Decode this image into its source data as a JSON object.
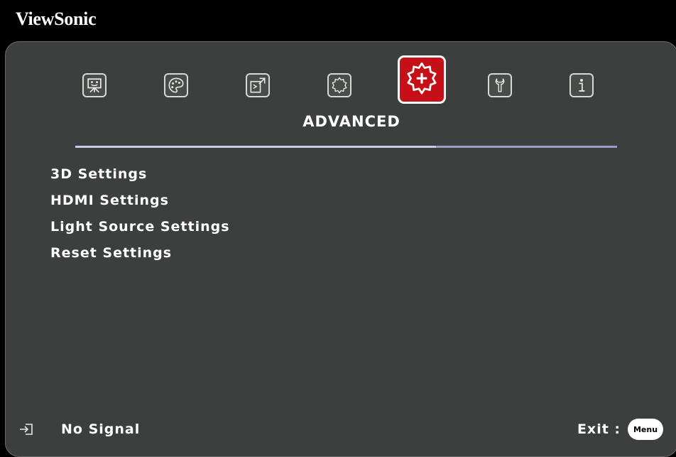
{
  "brand": "ViewSonic",
  "tabs": [
    {
      "icon": "display-icon",
      "active": false
    },
    {
      "icon": "palette-icon",
      "active": false
    },
    {
      "icon": "hand-touch-icon",
      "active": false
    },
    {
      "icon": "gear-icon",
      "active": false
    },
    {
      "icon": "gear-plus-icon",
      "active": true
    },
    {
      "icon": "wrench-icon",
      "active": false
    },
    {
      "icon": "info-icon",
      "active": false
    }
  ],
  "active_tab_title": "ADVANCED",
  "menu": {
    "items": [
      {
        "label": "3D Settings"
      },
      {
        "label": "HDMI Settings"
      },
      {
        "label": "Light Source Settings"
      },
      {
        "label": "Reset Settings"
      }
    ]
  },
  "footer": {
    "source_icon": "input-source-icon",
    "status": "No Signal",
    "exit_label": "Exit :",
    "menu_key": "Menu"
  },
  "colors": {
    "panel_bg": "#3c3f3d",
    "active_tab": "#c41016",
    "separator": "#c9cbe2",
    "text": "#ffffff"
  }
}
